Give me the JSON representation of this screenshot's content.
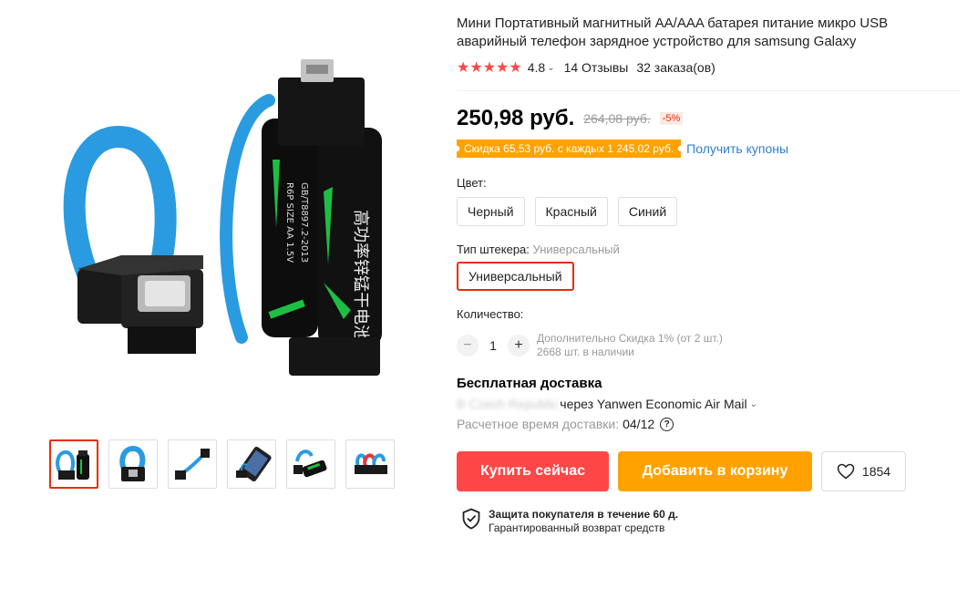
{
  "product": {
    "title": "Мини Портативный магнитный AA/AAA батарея питание микро USB аварийный телефон зарядное устройство для samsung Galaxy",
    "rating": {
      "stars": "★★★★★",
      "value": "4.8",
      "reviews": "14 Отзывы",
      "orders": "32 заказа(ов)"
    }
  },
  "price": {
    "current": "250,98 руб.",
    "old": "264,08 руб.",
    "discount": "-5%"
  },
  "coupon": {
    "badge": "Скидка 65,53 руб. с каждых 1 245,02 руб.",
    "link": "Получить купоны"
  },
  "sku": {
    "color_label": "Цвет:",
    "colors": [
      "Черный",
      "Красный",
      "Синий"
    ],
    "plug_label": "Тип штекера:",
    "plug_value": "Универсальный",
    "plug_option": "Универсальный"
  },
  "quantity": {
    "label": "Количество:",
    "minus": "−",
    "plus": "+",
    "value": "1",
    "extra_discount": "Дополнительно Скидка 1% (от 2 шт.)",
    "stock": "2668 шт. в наличии"
  },
  "shipping": {
    "title": "Бесплатная доставка",
    "to_blurred": "В Czech Republic",
    "method": "через Yanwen Economic Air Mail",
    "est_label": "Расчетное время доставки:",
    "est_date": "04/12"
  },
  "actions": {
    "buy": "Купить сейчас",
    "cart": "Добавить в корзину",
    "wishlist_count": "1854"
  },
  "protection": {
    "title": "Защита покупателя в течение 60 д.",
    "subtitle": "Гарантированный возврат средств"
  },
  "gallery": {
    "main_battery_text": "高功率锌锰干电池",
    "main_battery_spec": "R6P SIZE AA 1.5V",
    "main_battery_std": "GB/T8897.2-2013"
  },
  "colors": {
    "accent_red": "#ff4747",
    "accent_orange": "#ffa200",
    "link_blue": "#2e7ed3",
    "strap_blue": "#2a9be0",
    "battery_green": "#1dbf43"
  }
}
